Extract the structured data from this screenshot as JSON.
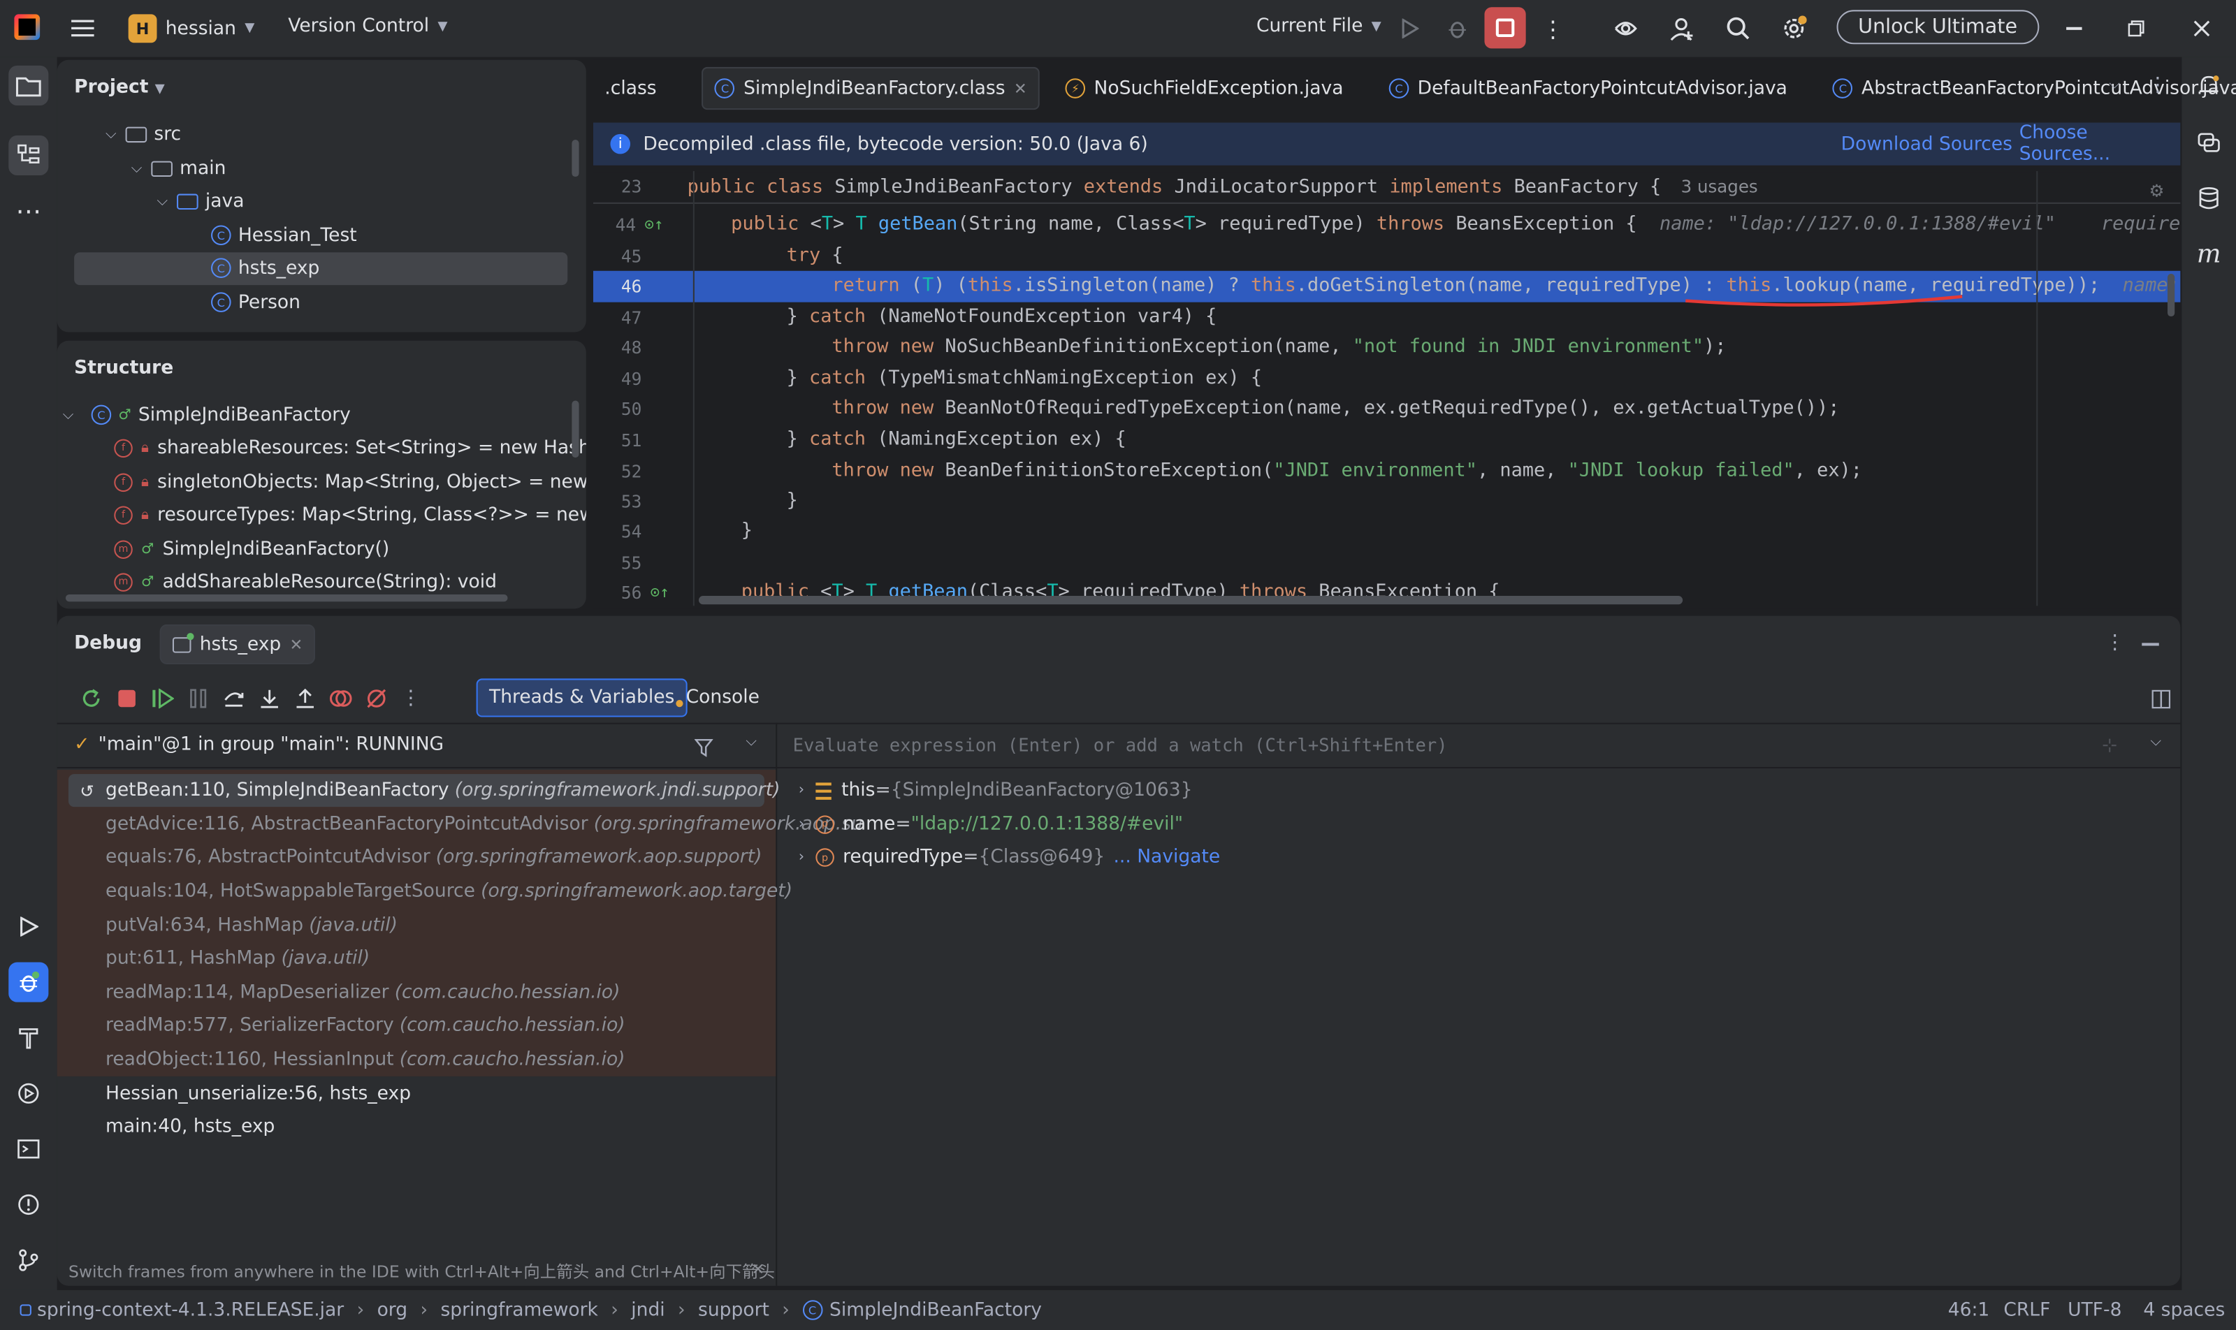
{
  "titlebar": {
    "project_letter": "H",
    "project": "hessian",
    "vcs": "Version Control",
    "run_config": "Current File",
    "unlock": "Unlock Ultimate"
  },
  "project_panel": {
    "title": "Project",
    "items": [
      "src",
      "main",
      "java",
      "Hessian_Test",
      "hsts_exp",
      "Person"
    ]
  },
  "structure_panel": {
    "title": "Structure",
    "items": [
      "SimpleJndiBeanFactory",
      "shareableResources: Set<String> = new HashSet()",
      "singletonObjects: Map<String, Object> = new HashM",
      "resourceTypes: Map<String, Class<?>> = new HashM",
      "SimpleJndiBeanFactory()",
      "addShareableResource(String): void"
    ]
  },
  "editor": {
    "tabs": [
      ".class",
      "SimpleJndiBeanFactory.class",
      "NoSuchFieldException.java",
      "DefaultBeanFactoryPointcutAdvisor.java",
      "AbstractBeanFactoryPointcutAdvisor.java"
    ],
    "banner": {
      "text": "Decompiled .class file, bytecode version: 50.0 (Java 6)",
      "download": "Download Sources",
      "choose": "Choose Sources..."
    },
    "line_numbers": [
      "23",
      "44",
      "45",
      "46",
      "47",
      "48",
      "49",
      "50",
      "51",
      "52",
      "53",
      "54",
      "55",
      "56"
    ],
    "usages": "3 usages",
    "hint_name": "name: \"ldap://127.0.0.1:1388/#evil\"",
    "hint_required": "require",
    "hint_name2": "name:"
  },
  "debug": {
    "title": "Debug",
    "session": "hsts_exp",
    "tab_threads": "Threads & Variables",
    "tab_console": "Console",
    "thread": "\"main\"@1 in group \"main\": RUNNING",
    "eval_placeholder": "Evaluate expression (Enter) or add a watch (Ctrl+Shift+Enter)",
    "frames": [
      {
        "m": "getBean:110, SimpleJndiBeanFactory",
        "p": "(org.springframework.jndi.support)"
      },
      {
        "m": "getAdvice:116, AbstractBeanFactoryPointcutAdvisor",
        "p": "(org.springframework.aop.su"
      },
      {
        "m": "equals:76, AbstractPointcutAdvisor",
        "p": "(org.springframework.aop.support)"
      },
      {
        "m": "equals:104, HotSwappableTargetSource",
        "p": "(org.springframework.aop.target)"
      },
      {
        "m": "putVal:634, HashMap",
        "p": "(java.util)"
      },
      {
        "m": "put:611, HashMap",
        "p": "(java.util)"
      },
      {
        "m": "readMap:114, MapDeserializer",
        "p": "(com.caucho.hessian.io)"
      },
      {
        "m": "readMap:577, SerializerFactory",
        "p": "(com.caucho.hessian.io)"
      },
      {
        "m": "readObject:1160, HessianInput",
        "p": "(com.caucho.hessian.io)"
      },
      {
        "m": "Hessian_unserialize:56, hsts_exp",
        "p": ""
      },
      {
        "m": "main:40, hsts_exp",
        "p": ""
      }
    ],
    "vars": [
      {
        "name": "this",
        "value": "{SimpleJndiBeanFactory@1063}",
        "extra": ""
      },
      {
        "name": "name",
        "value": "\"ldap://127.0.0.1:1388/#evil\"",
        "extra": ""
      },
      {
        "name": "requiredType",
        "value": "{Class@649}",
        "extra": "... Navigate"
      }
    ],
    "hint": "Switch frames from anywhere in the IDE with Ctrl+Alt+向上箭头 and Ctrl+Alt+向下箭头"
  },
  "statusbar": {
    "crumbs": [
      "spring-context-4.1.3.RELEASE.jar",
      "org",
      "springframework",
      "jndi",
      "support",
      "SimpleJndiBeanFactory"
    ],
    "pos": "46:1",
    "eol": "CRLF",
    "enc": "UTF-8",
    "indent": "4 spaces"
  }
}
